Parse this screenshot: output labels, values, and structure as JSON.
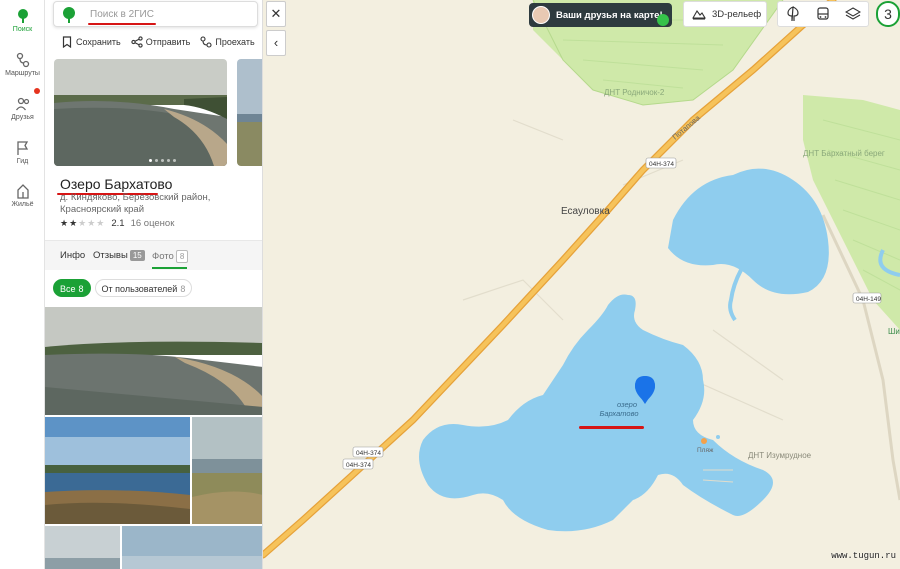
{
  "rail": {
    "items": [
      {
        "label": "Поиск",
        "icon": "search-logo-icon"
      },
      {
        "label": "Маршруты",
        "icon": "routes-icon"
      },
      {
        "label": "Друзья",
        "icon": "friends-icon"
      },
      {
        "label": "Гид",
        "icon": "flag-icon"
      },
      {
        "label": "Жильё",
        "icon": "home-icon"
      }
    ]
  },
  "search": {
    "placeholder": "Поиск в 2ГИС"
  },
  "actions": {
    "save": "Сохранить",
    "share": "Отправить",
    "route": "Проехать"
  },
  "place": {
    "title": "Озеро Бархатово",
    "address": "д. Киндяково, Берёзовский район, Красноярский край",
    "rating_value": "2.1",
    "reviews": "16 оценок",
    "stars": 2
  },
  "tabs": {
    "info": "Инфо",
    "reviews": "Отзывы",
    "reviews_count": "15",
    "photo": "Фото",
    "photo_count": "8"
  },
  "chips": {
    "all": "Все",
    "all_count": "8",
    "users": "От пользователей",
    "users_count": "8"
  },
  "map": {
    "labels": {
      "dnt_rodnichok": "ДНТ Родничок-2",
      "dnt_barhat": "ДНТ Бархатный берег",
      "esaulovka": "Есауловка",
      "road_potapova": "Потапова",
      "road_04n374a": "04Н-374",
      "road_04n374b": "04Н-374",
      "road_04n374c": "04Н-374",
      "road_04n149": "04Н-149",
      "lake1": "озеро",
      "lake2": "Бархатово",
      "dnt_izumrud": "ДНТ Изумрудное",
      "plyazh": "Пляж",
      "shi": "Ши"
    },
    "friends_banner": "Ваши друзья на карте!",
    "relief_label": "3D-рельеф",
    "zoom_value": "3",
    "watermark": "www.tugun.ru"
  },
  "colors": {
    "accent": "#1ba136",
    "water": "#8fcdee",
    "dacha": "#cfe9a9",
    "road": "#f5b53f",
    "pin": "#1a73e8",
    "highlight": "#d61515"
  }
}
